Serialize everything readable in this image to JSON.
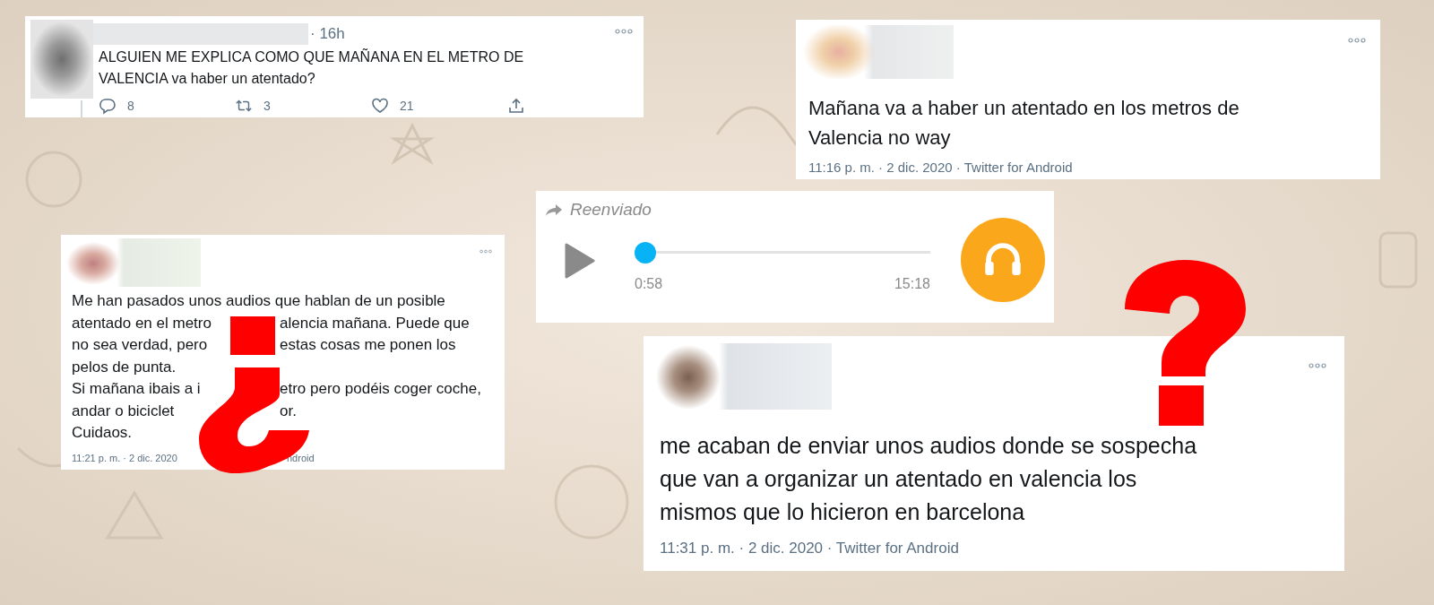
{
  "tweets": [
    {
      "kind": "compact",
      "time": "· 16h",
      "lines": [
        [
          "ALGUIEN ME EXPLICA COMO QUE MAÑANA EN EL METRO DE"
        ],
        [
          "VALENCIA va haber un atentado?"
        ]
      ],
      "actions": [
        {
          "kind": "reply",
          "count": "8"
        },
        {
          "kind": "retweet",
          "count": "3"
        },
        {
          "kind": "like",
          "count": "21"
        },
        {
          "kind": "share"
        }
      ]
    },
    {
      "kind": "medium",
      "lines": [
        [
          "Mañana va a haber un atentado en los metros de"
        ],
        [
          "Valencia no way"
        ]
      ],
      "footer": [
        "11:16 p. m. · 2 dic. 2020 · Twitter for Android"
      ]
    },
    {
      "kind": "small",
      "lines": [
        [
          "Me han pasados unos audios que hablan de un posible"
        ],
        [
          "atentado en el metro",
          "alencia mañana. Puede que"
        ],
        [
          "no sea verdad, pero",
          "estas cosas me ponen los"
        ],
        [
          "pelos de punta."
        ],
        [
          "Si mañana ibais a i",
          "etro pero podéis coger coche,"
        ],
        [
          "andar o biciclet",
          "or."
        ],
        [
          "Cuidaos."
        ]
      ],
      "footer": [
        "11:21 p. m. · 2 dic. 2020",
        "ndroid"
      ]
    },
    {
      "kind": "large",
      "lines": [
        [
          "me acaban de enviar unos audios donde se sospecha"
        ],
        [
          "que van a organizar un atentado en valencia los"
        ],
        [
          "mismos que lo hicieron en barcelona"
        ]
      ],
      "footer": [
        "11:31 p. m. · 2 dic. 2020 · Twitter for Android"
      ]
    }
  ],
  "audio": {
    "forwarded": "Reenviado",
    "level": 0,
    "elapsed": "0:58",
    "duration": "15:18"
  }
}
